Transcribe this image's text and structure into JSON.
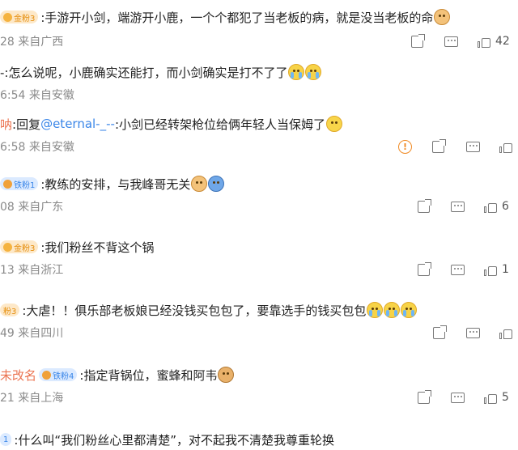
{
  "comments": [
    {
      "prefix_badge": "金粉3",
      "text": ":手游开小剑，端游开小鹿，一个个都犯了当老板的病，就是没当老板的命",
      "time": "28 来自广西",
      "likes": "42",
      "emoji": [
        "dog-icon"
      ]
    },
    {
      "text": "-:怎么说呢，小鹿确实还能打，而小剑确实是打不了了",
      "time": "6:54 来自安徽",
      "emoji": [
        "crying-face-icon",
        "crying-face-icon"
      ]
    },
    {
      "name": "呐",
      "reply": ":回复",
      "mention": "@eternal-_--",
      "text": ":小剑已经转架枪位给俩年轻人当保姆了",
      "time": "6:58 来自安徽",
      "emoji": [
        "sleepy-face-icon"
      ]
    },
    {
      "prefix_badge": "铁粉1",
      "text": ":教练的安排，与我峰哥无关",
      "time": "08 来自广东",
      "likes": "6",
      "emoji": [
        "dog-icon",
        "hand-on-head-icon"
      ]
    },
    {
      "prefix_badge": "金粉3",
      "text": ":我们粉丝不背这个锅",
      "time": "13 来自浙江",
      "likes": "1"
    },
    {
      "prefix_badge": "粉3",
      "text": ":大虐！！俱乐部老板娘已经没钱买包包了，要靠选手的钱买包包",
      "time": "49 来自四川",
      "emoji": [
        "crying-face-icon",
        "crying-face-icon",
        "crying-face-icon"
      ]
    },
    {
      "name": "未改名",
      "prefix_badge": "铁粉4",
      "text": ":指定背锅位，蜜蜂和阿韦",
      "time": "21 来自上海",
      "likes": "5",
      "emoji": [
        "bear-face-icon"
      ]
    },
    {
      "prefix_badge": "1",
      "text": ":什么叫“我们粉丝心里都清楚”，对不起我不清楚我尊重轮换"
    }
  ],
  "report_symbol": "!"
}
